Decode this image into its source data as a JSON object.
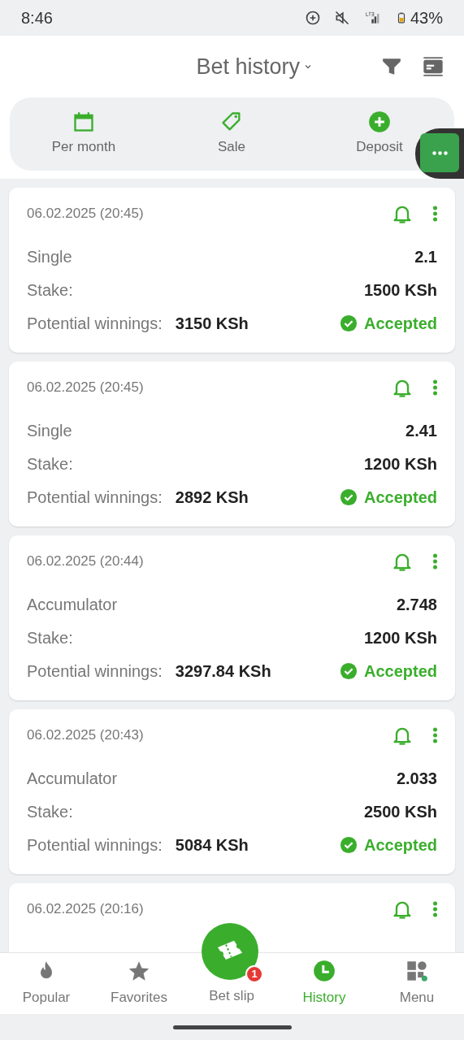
{
  "status_bar": {
    "time": "8:46",
    "battery": "43%"
  },
  "header": {
    "title": "Bet history"
  },
  "quick_actions": [
    {
      "label": "Per month",
      "kind": "calendar"
    },
    {
      "label": "Sale",
      "kind": "tag"
    },
    {
      "label": "Deposit",
      "kind": "plus"
    }
  ],
  "bets": [
    {
      "date": "06.02.2025 (20:45)",
      "type": "Single",
      "odds": "2.1",
      "stake_label": "Stake:",
      "stake": "1500 KSh",
      "winnings_label": "Potential winnings:",
      "winnings": "3150 KSh",
      "status": {
        "text": "Accepted",
        "kind": "accepted"
      }
    },
    {
      "date": "06.02.2025 (20:45)",
      "type": "Single",
      "odds": "2.41",
      "stake_label": "Stake:",
      "stake": "1200 KSh",
      "winnings_label": "Potential winnings:",
      "winnings": "2892 KSh",
      "status": {
        "text": "Accepted",
        "kind": "accepted"
      }
    },
    {
      "date": "06.02.2025 (20:44)",
      "type": "Accumulator",
      "odds": "2.748",
      "stake_label": "Stake:",
      "stake": "1200 KSh",
      "winnings_label": "Potential winnings:",
      "winnings": "3297.84 KSh",
      "status": {
        "text": "Accepted",
        "kind": "accepted"
      }
    },
    {
      "date": "06.02.2025 (20:43)",
      "type": "Accumulator",
      "odds": "2.033",
      "stake_label": "Stake:",
      "stake": "2500 KSh",
      "winnings_label": "Potential winnings:",
      "winnings": "5084 KSh",
      "status": {
        "text": "Accepted",
        "kind": "accepted"
      }
    },
    {
      "date": "06.02.2025 (20:16)"
    }
  ],
  "bottom_nav": [
    {
      "label": "Popular",
      "kind": "flame",
      "selected": false
    },
    {
      "label": "Favorites",
      "kind": "star",
      "selected": false
    },
    {
      "label": "Bet slip",
      "kind": "slip",
      "selected": false,
      "badge": "1"
    },
    {
      "label": "History",
      "kind": "clock",
      "selected": true
    },
    {
      "label": "Menu",
      "kind": "grid",
      "selected": false
    }
  ]
}
